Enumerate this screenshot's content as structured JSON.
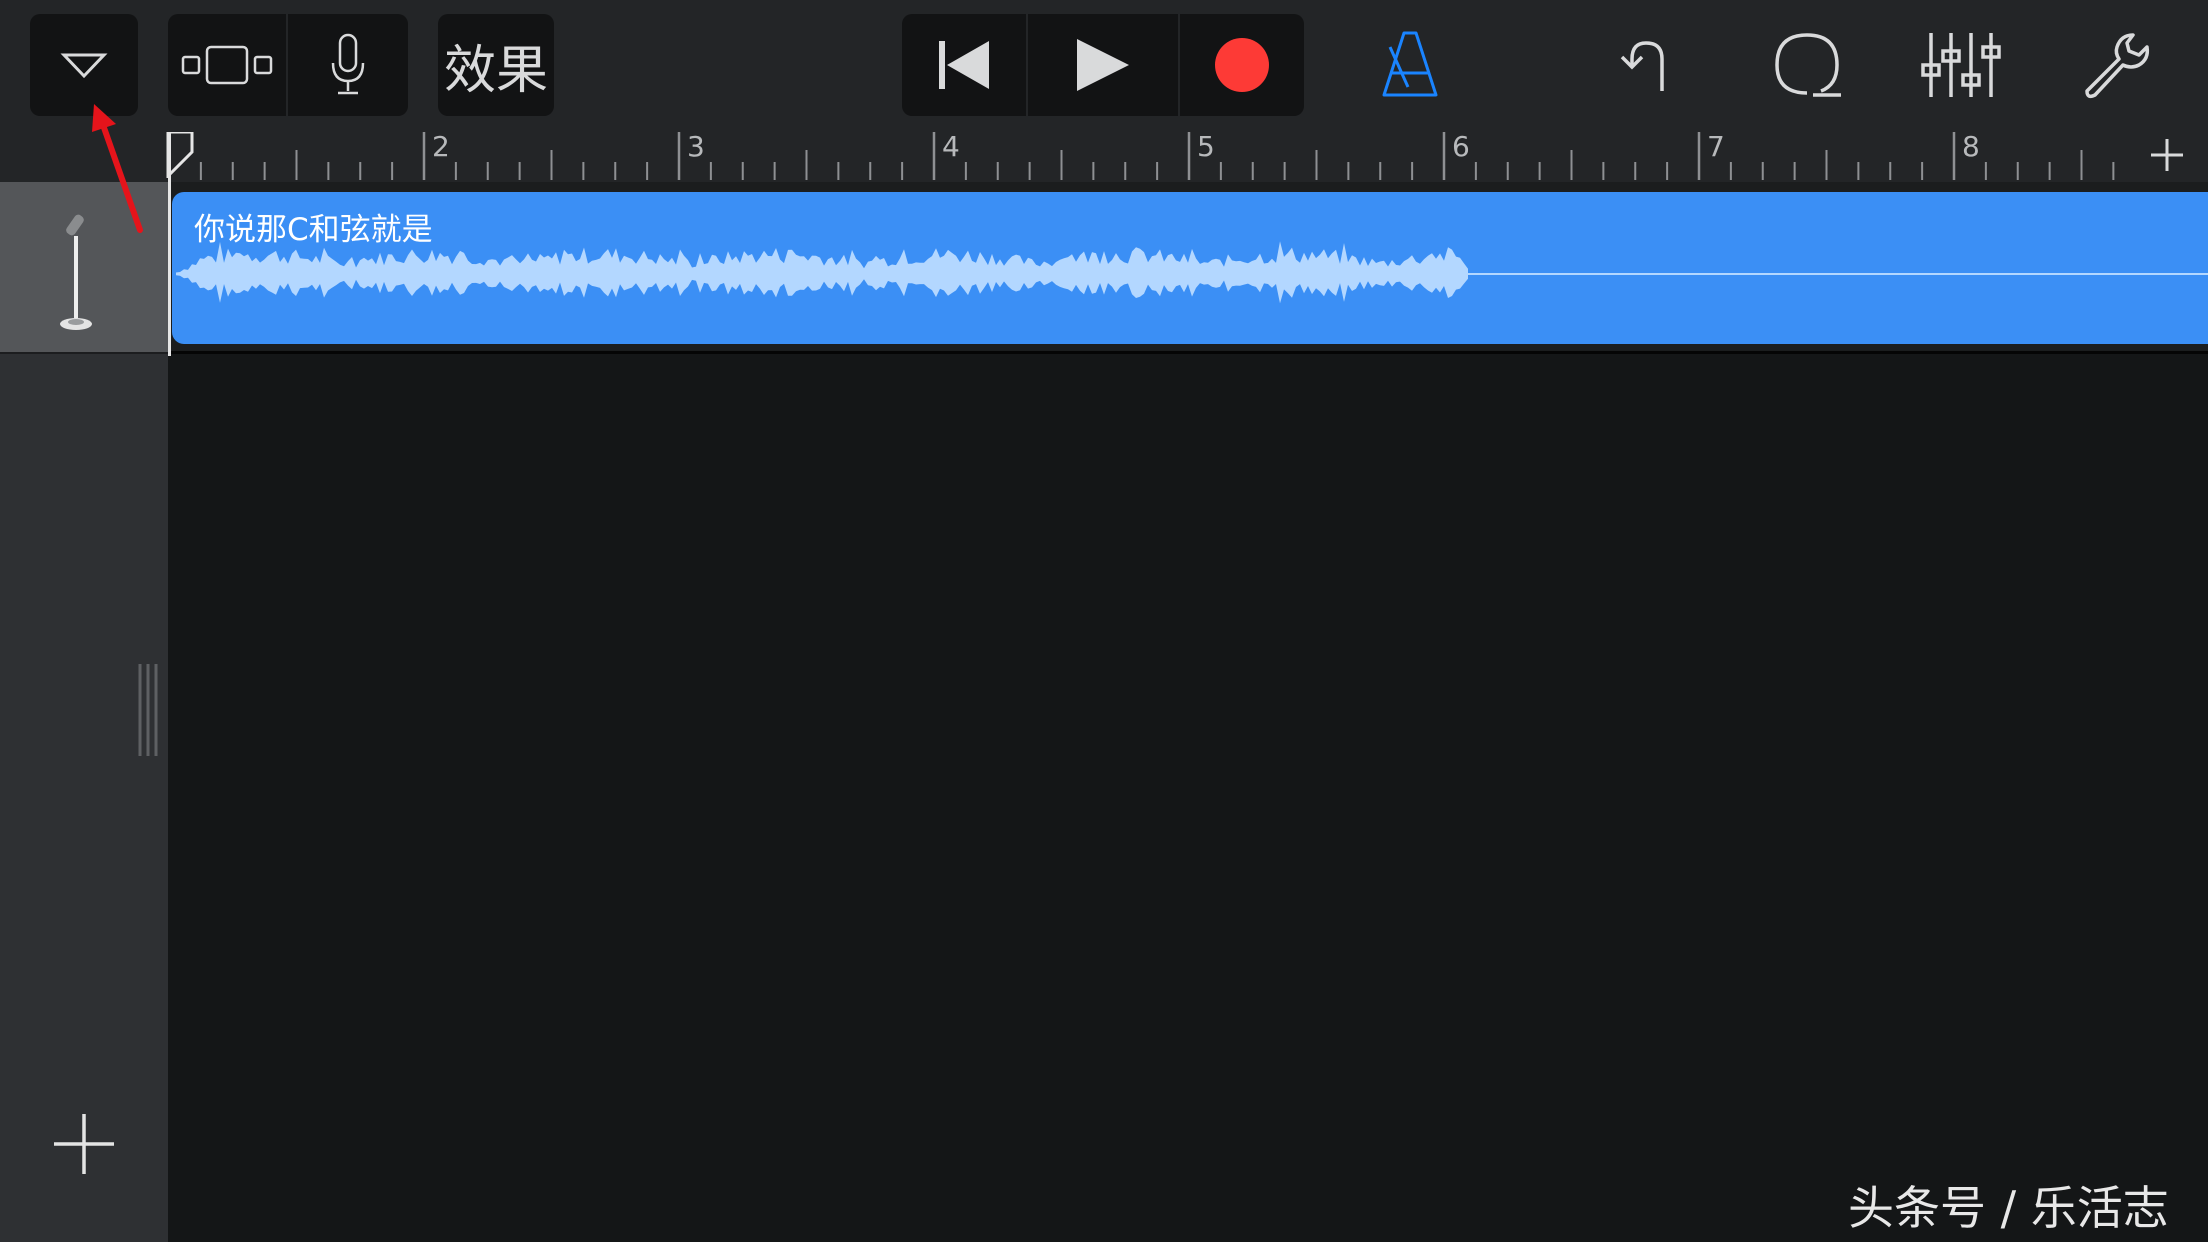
{
  "toolbar": {
    "menu_icon": "triangle-down-icon",
    "browser_icon": "browser-view-icon",
    "instrument_icon": "microphone-icon",
    "fx_label": "效果",
    "rewind_icon": "go-to-beginning-icon",
    "play_icon": "play-icon",
    "record_icon": "record-icon",
    "metronome_icon": "metronome-icon",
    "undo_icon": "undo-icon",
    "loop_icon": "loop-icon",
    "mixer_icon": "mixer-icon",
    "settings_icon": "wrench-icon",
    "record_color": "#fd3a36",
    "metronome_color": "#1a84ff"
  },
  "ruler": {
    "bars": [
      "2",
      "3",
      "4",
      "5",
      "6",
      "7",
      "8"
    ],
    "add_section_icon": "plus-icon"
  },
  "track": {
    "instrument_icon": "microphone-stand-icon",
    "region": {
      "name": "你说那C和弦就是",
      "color": "#3b8ff5",
      "waveform_color": "#b3d7ff"
    }
  },
  "sidebar": {
    "add_track_icon": "plus-icon"
  },
  "annotation": {
    "color": "#e5141b"
  },
  "watermark": {
    "text": "头条号 / 乐活志"
  }
}
